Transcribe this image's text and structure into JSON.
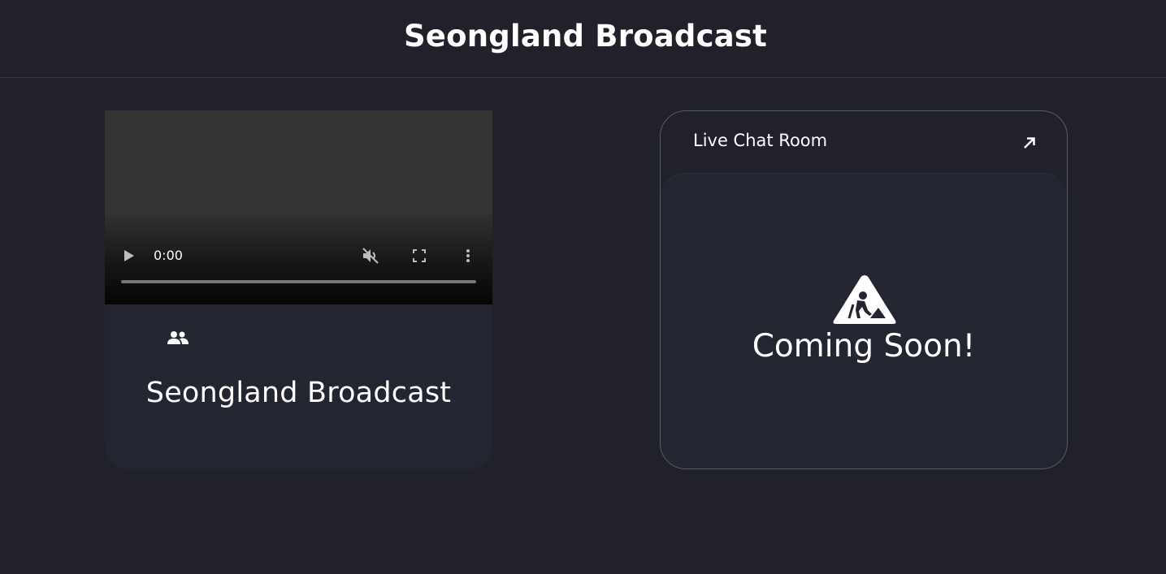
{
  "header": {
    "title": "Seongland Broadcast"
  },
  "player": {
    "time": "0:00",
    "progress": 0,
    "muted": true
  },
  "stream_card": {
    "viewer_count": "",
    "title": "Seongland Broadcast"
  },
  "chat": {
    "title": "Live Chat Room",
    "status": "Coming Soon!"
  },
  "icons": {
    "viewers": "users-icon",
    "open_external": "arrow-up-right-icon",
    "construction": "construction-warning-icon",
    "play": "play-icon",
    "mute": "volume-muted-icon",
    "fullscreen": "fullscreen-icon",
    "more": "more-vertical-icon"
  },
  "colors": {
    "background": "#20212a",
    "card": "#232531",
    "text": "#ffffff"
  }
}
